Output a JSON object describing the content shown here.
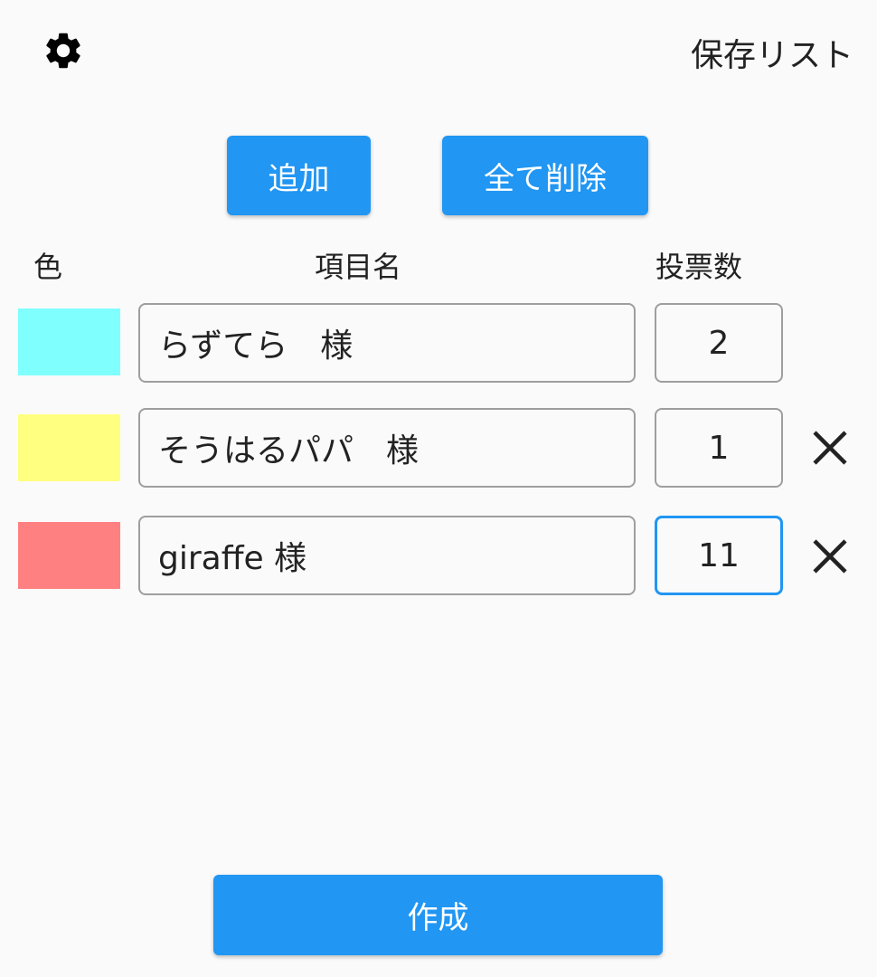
{
  "header": {
    "settings_icon": "gear-icon",
    "saved_list_label": "保存リスト"
  },
  "actions": {
    "add_label": "追加",
    "clear_all_label": "全て削除",
    "create_label": "作成"
  },
  "columns": {
    "color": "色",
    "name": "項目名",
    "votes": "投票数"
  },
  "items": [
    {
      "color": "#80ffff",
      "name": "らずてら　様",
      "votes": "2",
      "removable": false
    },
    {
      "color": "#ffff80",
      "name": "そうはるパパ　様",
      "votes": "1",
      "removable": true
    },
    {
      "color": "#ff8080",
      "name": "giraffe 様",
      "votes": "11",
      "removable": true
    }
  ],
  "colors": {
    "accent": "#2196f3",
    "field_border": "#9e9e9e",
    "background": "#fafafa"
  }
}
